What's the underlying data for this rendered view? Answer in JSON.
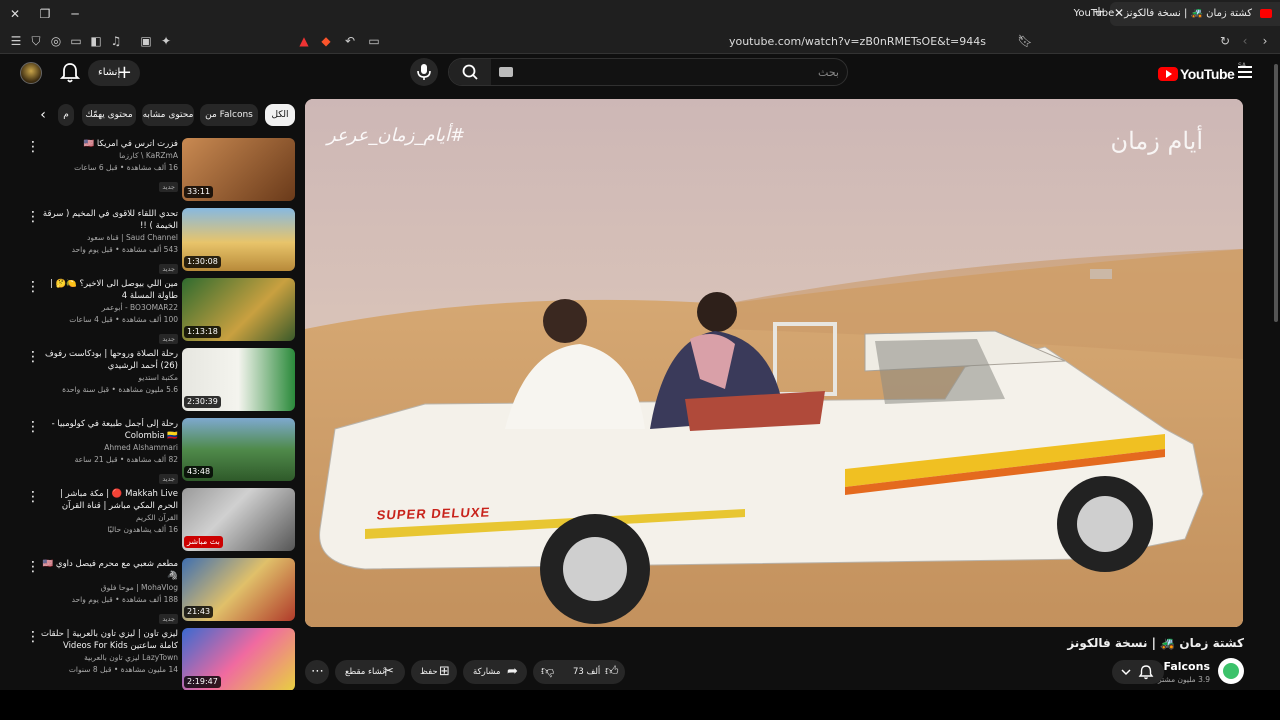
{
  "browser": {
    "tab_title": "كشتة زمان 🚜 | نسخة فالكونز - YouTube",
    "url": "youtube.com/watch?v=zB0nRMETsOE&t=944s",
    "favicon_color": "#ff0000"
  },
  "header": {
    "create_label": "إنشاء",
    "search_placeholder": "بحث",
    "logo_text": "YouTube",
    "logo_region": "SA"
  },
  "chips": [
    {
      "label": "الكل",
      "active": true
    },
    {
      "label": "من Falcons",
      "active": false
    },
    {
      "label": "محتوى مشابه",
      "active": false
    },
    {
      "label": "محتوى يهمّك",
      "active": false
    },
    {
      "label": "م",
      "active": false
    }
  ],
  "recommendations": [
    {
      "title": "فزرت اترس في امريكا 🇺🇸",
      "channel": "KaRZmA \\ كارزما",
      "meta": "16 ألف مشاهدة • قبل 6 ساعات",
      "badge": "جديد",
      "duration": "33:11",
      "thumb_color": "#a66a3a"
    },
    {
      "title": "تحدي اللقاء للاقوى في المخيم ( سرقة الخيمة ) !!",
      "channel": "Saud Channel | قناة سعود",
      "meta": "543 ألف مشاهدة • قبل يوم واحد",
      "badge": "جديد",
      "duration": "1:30:08",
      "thumb_color": "#d9b24a"
    },
    {
      "title": "مين اللي بيوصل الى الاخير؟ 🍋🤔 | طاولة المسلة 4",
      "channel": "BO3OMAR22 - أبوعمر",
      "meta": "100 ألف مشاهدة • قبل 4 ساعات",
      "badge": "جديد",
      "duration": "1:13:18",
      "thumb_color": "#3a7a3a"
    },
    {
      "title": "رحلة الصلاة وروحها | بودكاست رفوف (26) أحمد الرشيدي",
      "channel": "مكتبة استديو",
      "meta": "5.6 مليون مشاهدة • قبل سنة واحدة",
      "badge": "",
      "duration": "2:30:39",
      "thumb_color": "#d9d9d0"
    },
    {
      "title": "رحلة إلى أجمل طبيعة في كولومبيا - Colombia 🇨🇴",
      "channel": "Ahmed Alshammari",
      "meta": "82 ألف مشاهدة • قبل 21 ساعة",
      "badge": "جديد",
      "duration": "43:48",
      "thumb_color": "#5a8a4a"
    },
    {
      "title": "Makkah Live 🔴 | مكة مباشر | الحرم المكي مباشر | قناة القرآن الكريم السعودية ...",
      "channel": "القرآن الكريم",
      "meta": "16 ألف يشاهدون حاليًا",
      "badge": "",
      "duration": "بث مباشر",
      "thumb_color": "#8a8a8a",
      "live": true
    },
    {
      "title": "مطعم شعبي مع محرم فيصل داوي 🇺🇸🦓",
      "channel": "MohaVlog | موحا فلوق",
      "meta": "188 ألف مشاهدة • قبل يوم واحد",
      "badge": "جديد",
      "duration": "21:43",
      "thumb_color": "#4a6a9a"
    },
    {
      "title": "ليزي تاون | ليزي تاون بالعربية | حلقات كاملة ساعتين Videos For Kids",
      "channel": "LazyTown ليزي تاون بالعربية",
      "meta": "14 مليون مشاهدة • قبل 8 سنوات",
      "badge": "",
      "duration": "2:19:47",
      "thumb_color": "#e05a9a"
    }
  ],
  "video": {
    "hashtag_overlay": "#أيام_زمان_عرعر",
    "brand_overlay": "أيام زمان",
    "truck_text": "SUPER DELUXE",
    "title": "كشتة زمان 🚜 | نسخة فالكونز",
    "channel_name": "Falcons",
    "subscribers": "3.9 مليون مشترك"
  },
  "actions": {
    "likes": "73 ألف",
    "share_label": "مشاركة",
    "save_label": "حفظ",
    "clip_label": "إنشاء مقطع"
  }
}
